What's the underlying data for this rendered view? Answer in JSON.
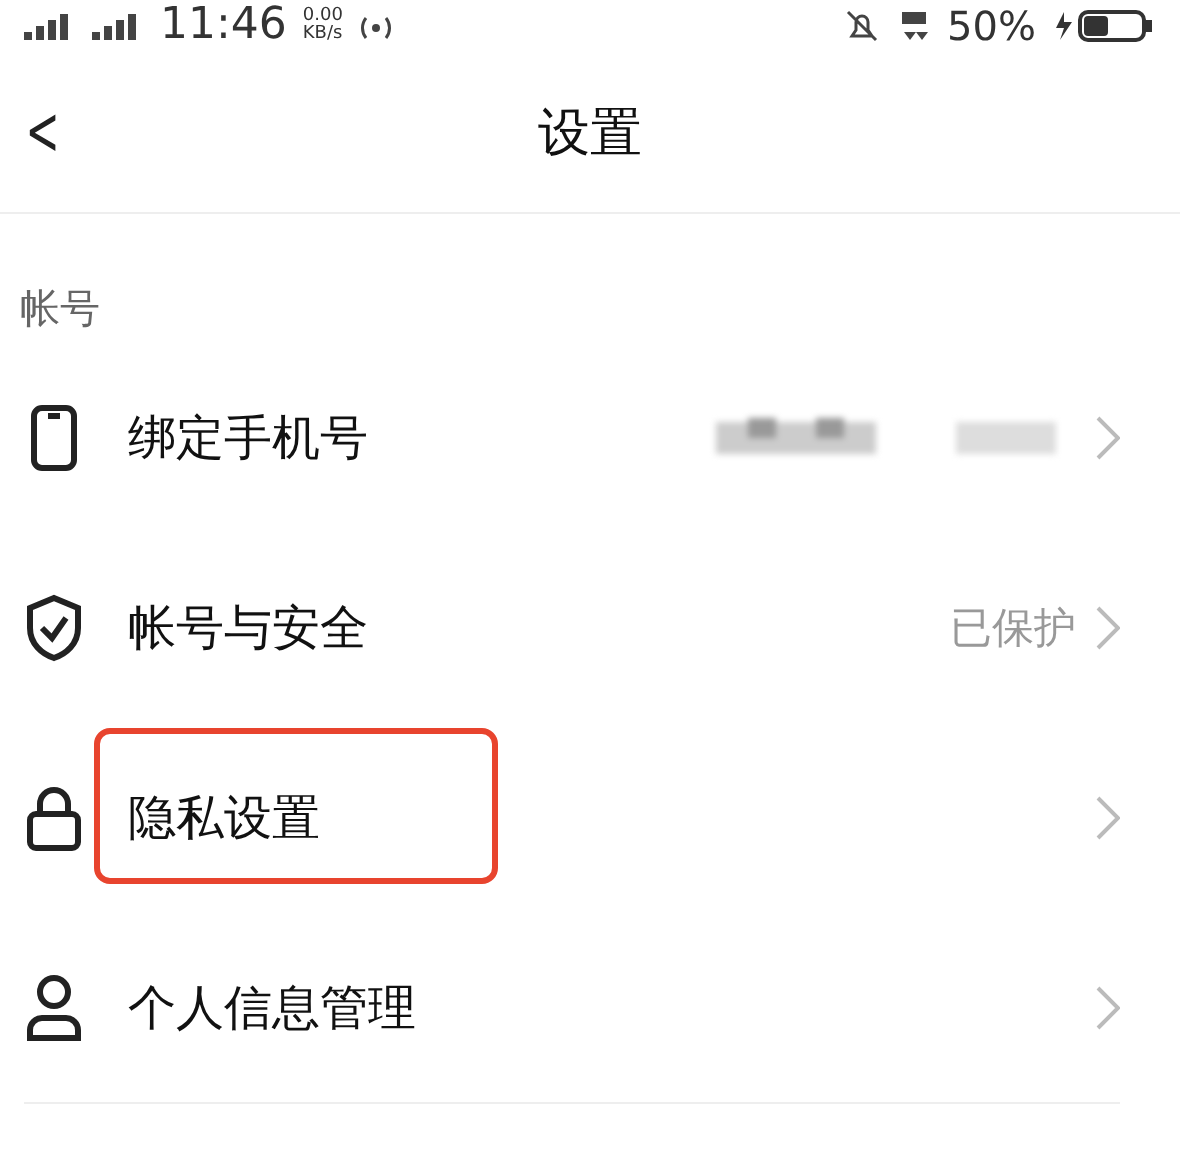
{
  "status_bar": {
    "time": "11:46",
    "speed_value": "0.00",
    "speed_unit": "KB/s",
    "battery": "50%"
  },
  "header": {
    "back_icon": "<",
    "title": "设置"
  },
  "section": {
    "title": "帐号"
  },
  "rows": [
    {
      "kind": "phone",
      "label": "绑定手机号",
      "value_redacted": true,
      "highlighted": false
    },
    {
      "kind": "shield",
      "label": "帐号与安全",
      "value": "已保护",
      "highlighted": false
    },
    {
      "kind": "lock",
      "label": "隐私设置",
      "highlighted": true
    },
    {
      "kind": "person",
      "label": "个人信息管理",
      "highlighted": false
    }
  ]
}
